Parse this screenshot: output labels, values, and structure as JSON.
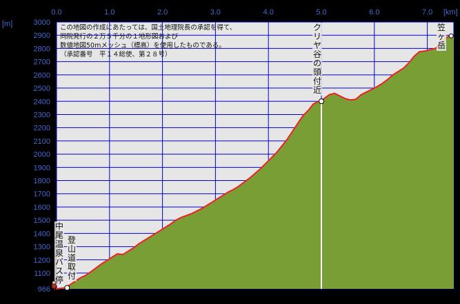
{
  "chart_data": {
    "type": "area",
    "xlabel": "km",
    "ylabel": "m",
    "xlim": [
      0,
      7.5
    ],
    "ylim": [
      966,
      3000
    ],
    "x_ticks": [
      "0.0",
      "1.0",
      "2.0",
      "3.0",
      "4.0",
      "5.0",
      "6.0",
      "7.0"
    ],
    "y_ticks": [
      "3000",
      "2900",
      "2800",
      "2700",
      "2600",
      "2500",
      "2400",
      "2300",
      "2200",
      "2100",
      "2000",
      "1900",
      "1800",
      "1700",
      "1600",
      "1500",
      "1400",
      "1300",
      "1200",
      "1100"
    ],
    "y_base_label": "966",
    "grid": true,
    "colors": {
      "profile_line": "#ee2222",
      "fill": "#7a9e36",
      "plot_bg": "#e6e6e6",
      "axis_text": "#4468d0"
    },
    "profile": {
      "x": [
        -0.05,
        0.0,
        0.15,
        0.25,
        0.35,
        0.45,
        0.55,
        0.65,
        0.75,
        0.85,
        0.95,
        1.05,
        1.15,
        1.25,
        1.35,
        1.45,
        1.55,
        1.65,
        1.75,
        1.85,
        1.95,
        2.05,
        2.15,
        2.25,
        2.35,
        2.45,
        2.55,
        2.65,
        2.75,
        2.85,
        2.95,
        3.05,
        3.15,
        3.25,
        3.35,
        3.45,
        3.55,
        3.65,
        3.75,
        3.85,
        3.95,
        4.05,
        4.15,
        4.25,
        4.35,
        4.45,
        4.55,
        4.65,
        4.75,
        4.85,
        4.95,
        5.05,
        5.15,
        5.25,
        5.35,
        5.45,
        5.55,
        5.65,
        5.75,
        5.85,
        5.95,
        6.05,
        6.15,
        6.25,
        6.35,
        6.45,
        6.55,
        6.65,
        6.75,
        6.85,
        6.95,
        7.05,
        7.15,
        7.22,
        7.3,
        7.35,
        7.4,
        7.45,
        7.5
      ],
      "y": [
        966,
        966,
        975,
        1000,
        1030,
        1060,
        1080,
        1110,
        1140,
        1170,
        1195,
        1220,
        1245,
        1240,
        1265,
        1290,
        1320,
        1345,
        1370,
        1395,
        1420,
        1445,
        1470,
        1500,
        1520,
        1535,
        1550,
        1570,
        1590,
        1615,
        1640,
        1665,
        1690,
        1715,
        1735,
        1760,
        1790,
        1820,
        1855,
        1890,
        1930,
        1970,
        2010,
        2060,
        2110,
        2170,
        2230,
        2290,
        2330,
        2380,
        2400,
        2420,
        2450,
        2460,
        2440,
        2420,
        2410,
        2415,
        2450,
        2470,
        2490,
        2510,
        2535,
        2565,
        2600,
        2625,
        2650,
        2690,
        2740,
        2775,
        2780,
        2790,
        2800,
        2820,
        2860,
        2880,
        2890,
        2895,
        2895
      ]
    },
    "points": [
      {
        "name": "中尾温泉バス停",
        "x": -0.05,
        "y": 966
      },
      {
        "name": "登山道取付",
        "x": 0.2,
        "y": 975
      },
      {
        "name": "クリヤ谷の頭付近",
        "x": 5.0,
        "y": 2400
      },
      {
        "name": "笠ヶ岳",
        "x": 7.45,
        "y": 2895
      }
    ],
    "annotation_lines": [
      "この地図の作成にあたっては、国土地理院長の承認を得て、",
      "同院発行の２万５千分の１地形図および",
      "数値地図50mメッシュ（標高）を使用したものである。",
      "（承認番号　平１４総使、第２８号）"
    ]
  }
}
